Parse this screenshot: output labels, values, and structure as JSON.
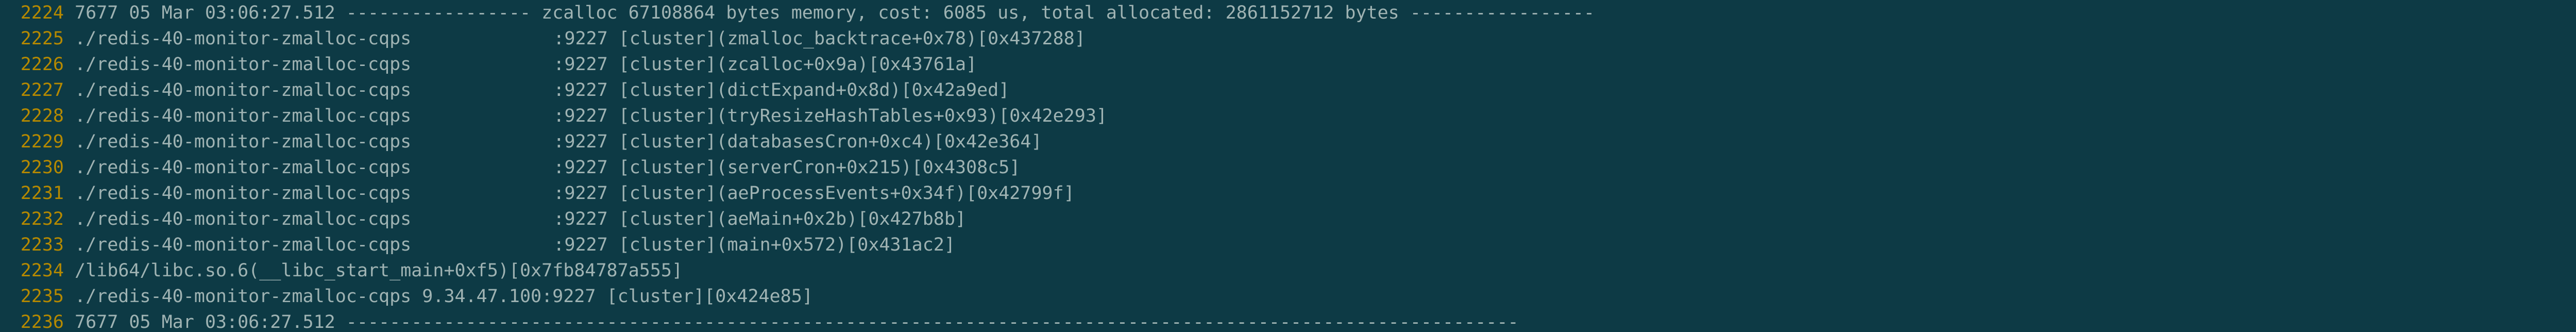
{
  "colors": {
    "background": "#0d3a45",
    "text": "#9fb3b3",
    "line_number": "#b58900"
  },
  "lines": [
    {
      "num": "2224",
      "text": "7677 05 Mar 03:06:27.512 ----------------- zcalloc 67108864 bytes memory, cost: 6085 us, total allocated: 2861152712 bytes -----------------"
    },
    {
      "num": "2225",
      "prefix": "./redis-40-monitor-zmalloc-cqps ",
      "suffix": ":9227 [cluster](zmalloc_backtrace+0x78)[0x437288]"
    },
    {
      "num": "2226",
      "prefix": "./redis-40-monitor-zmalloc-cqps ",
      "suffix": ":9227 [cluster](zcalloc+0x9a)[0x43761a]"
    },
    {
      "num": "2227",
      "prefix": "./redis-40-monitor-zmalloc-cqps ",
      "suffix": ":9227 [cluster](dictExpand+0x8d)[0x42a9ed]"
    },
    {
      "num": "2228",
      "prefix": "./redis-40-monitor-zmalloc-cqps ",
      "suffix": ":9227 [cluster](tryResizeHashTables+0x93)[0x42e293]"
    },
    {
      "num": "2229",
      "prefix": "./redis-40-monitor-zmalloc-cqps ",
      "suffix": ":9227 [cluster](databasesCron+0xc4)[0x42e364]"
    },
    {
      "num": "2230",
      "prefix": "./redis-40-monitor-zmalloc-cqps ",
      "suffix": ":9227 [cluster](serverCron+0x215)[0x4308c5]"
    },
    {
      "num": "2231",
      "prefix": "./redis-40-monitor-zmalloc-cqps ",
      "suffix": ":9227 [cluster](aeProcessEvents+0x34f)[0x42799f]"
    },
    {
      "num": "2232",
      "prefix": "./redis-40-monitor-zmalloc-cqps ",
      "suffix": ":9227 [cluster](aeMain+0x2b)[0x427b8b]"
    },
    {
      "num": "2233",
      "prefix": "./redis-40-monitor-zmalloc-cqps ",
      "suffix": ":9227 [cluster](main+0x572)[0x431ac2]"
    },
    {
      "num": "2234",
      "text": "/lib64/libc.so.6(__libc_start_main+0xf5)[0x7fb84787a555]"
    },
    {
      "num": "2235",
      "text": "./redis-40-monitor-zmalloc-cqps 9.34.47.100:9227 [cluster][0x424e85]"
    },
    {
      "num": "2236",
      "text": "7677 05 Mar 03:06:27.512 ------------------------------------------------------------------------------------------------------------"
    }
  ]
}
